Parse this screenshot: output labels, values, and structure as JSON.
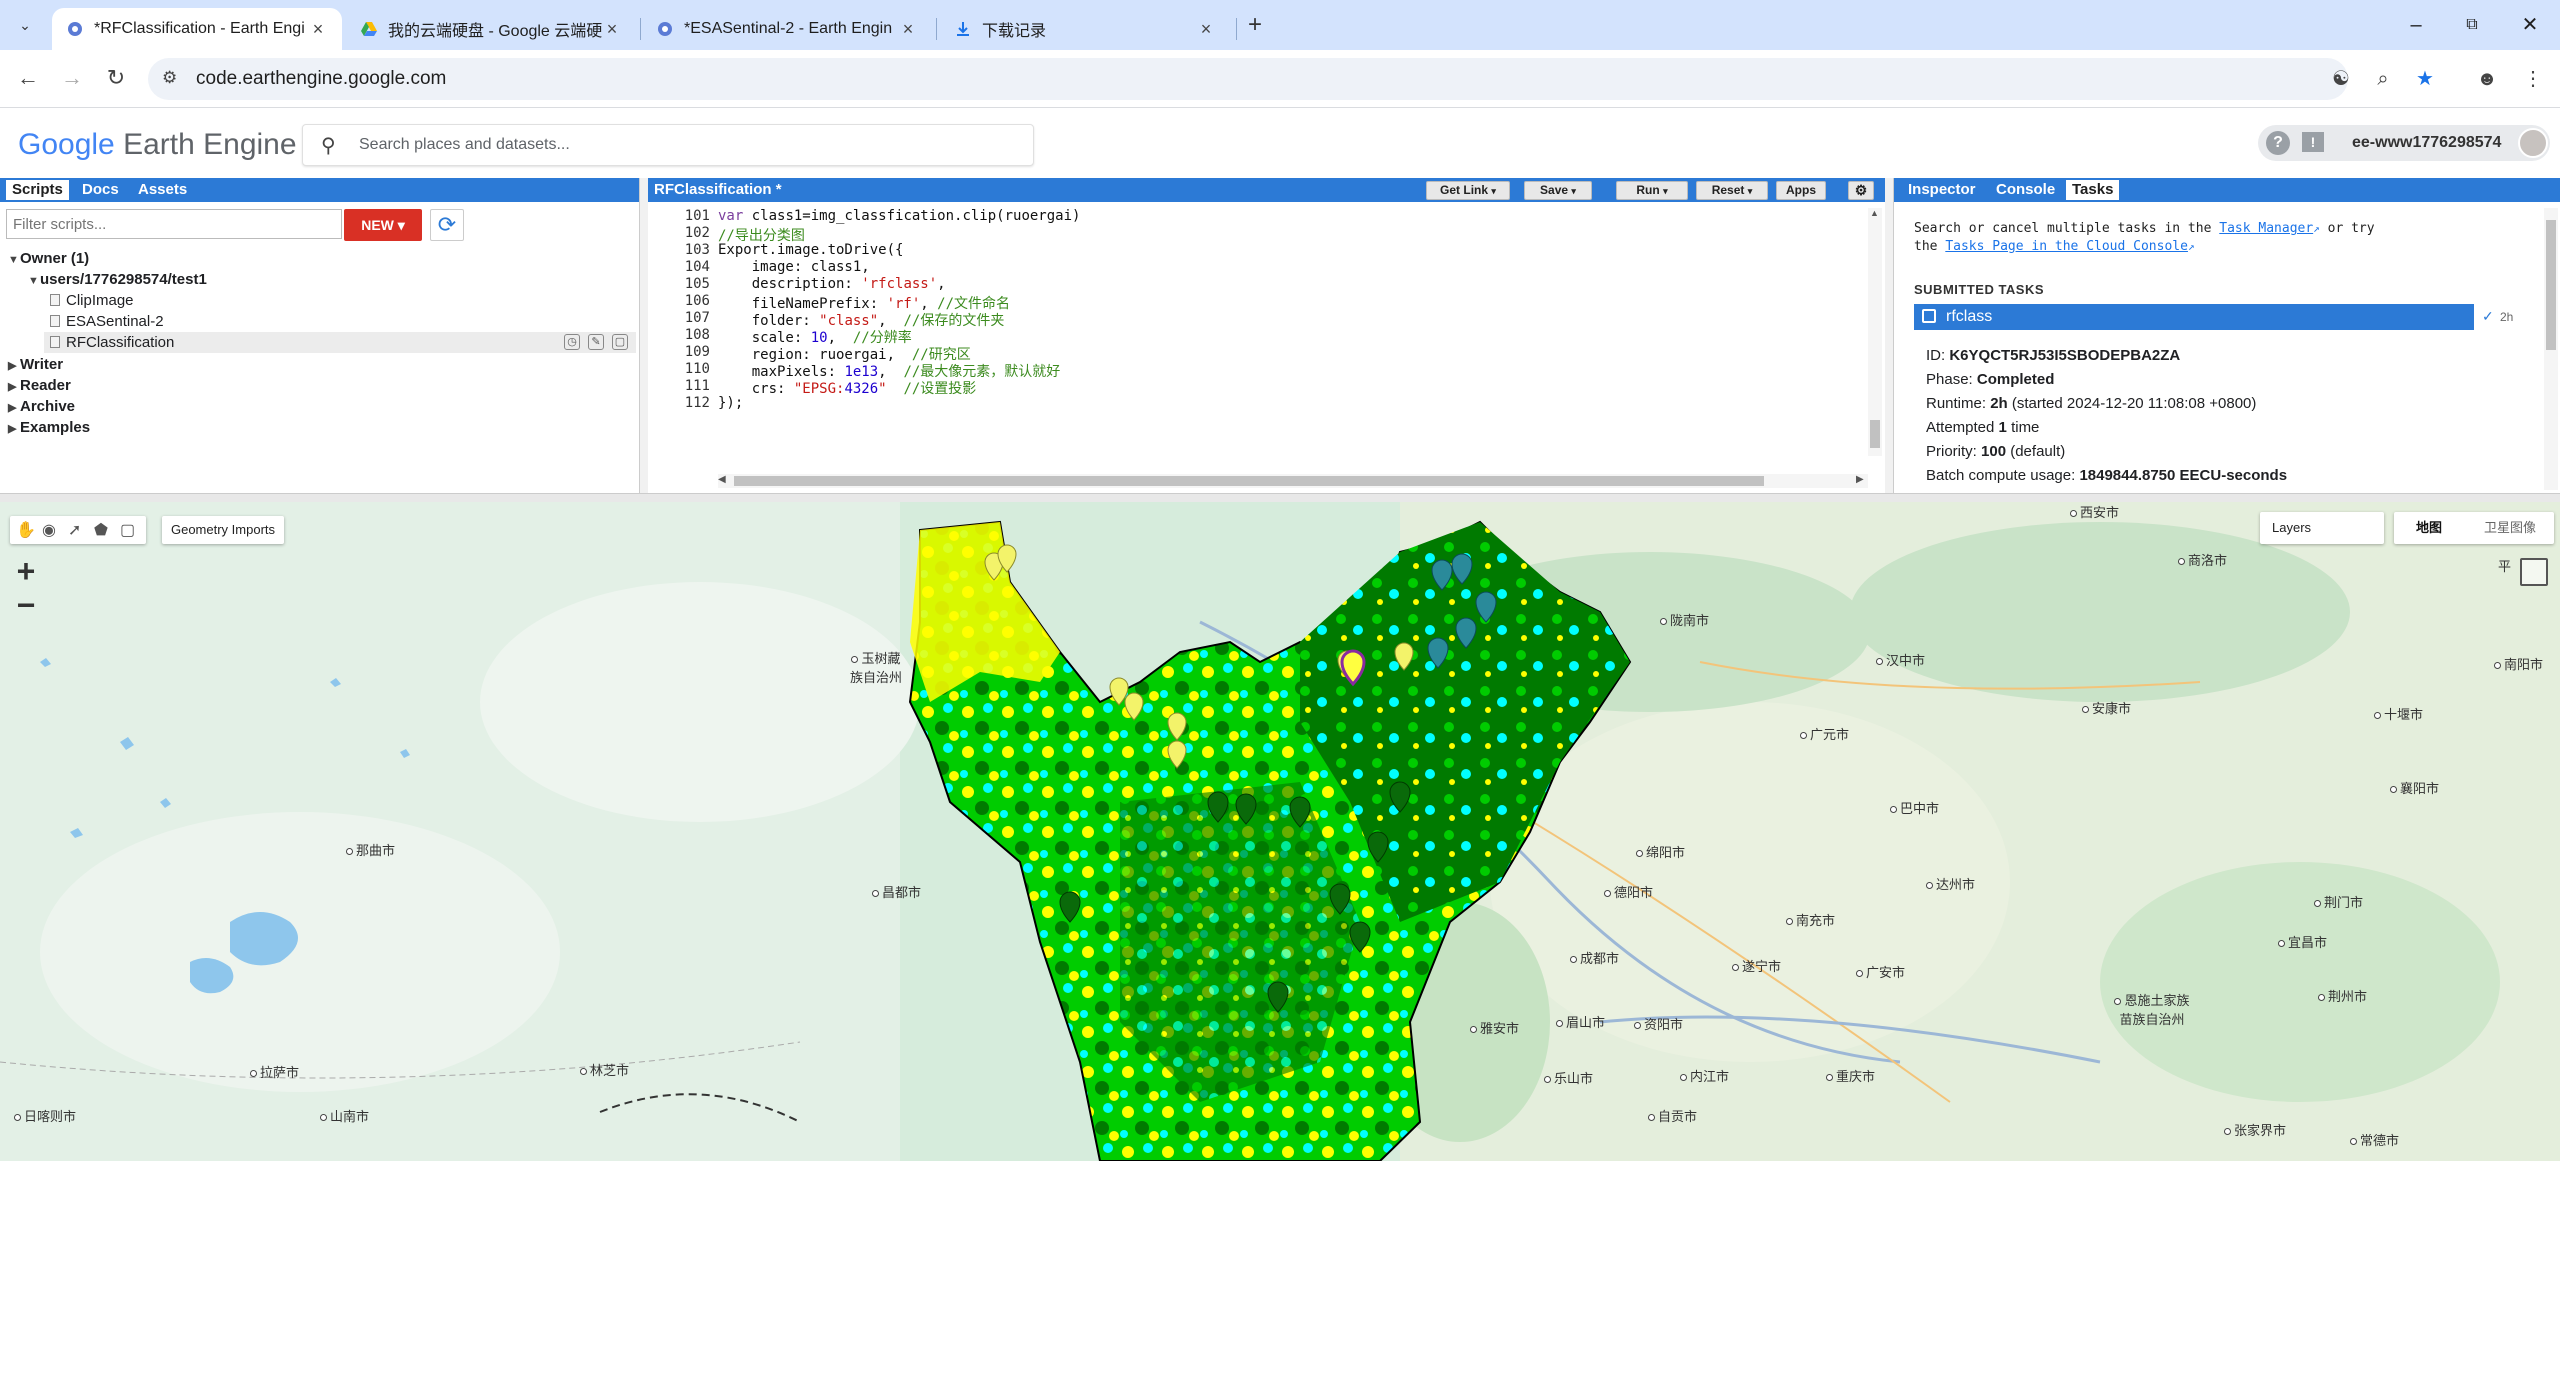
{
  "browser": {
    "tabs": [
      {
        "title": "*RFClassification - Earth Engi",
        "active": true
      },
      {
        "title": "我的云端硬盘 - Google 云端硬",
        "active": false
      },
      {
        "title": "*ESASentinal-2 - Earth Engin",
        "active": false
      },
      {
        "title": "下载记录",
        "active": false
      }
    ],
    "new_tab": "+",
    "url": "code.earthengine.google.com"
  },
  "gee": {
    "logo_google": "Google",
    "logo_product": "Earth Engine",
    "search_placeholder": "Search places and datasets...",
    "username": "ee-www1776298574"
  },
  "left_panel": {
    "tabs": [
      "Scripts",
      "Docs",
      "Assets"
    ],
    "filter_placeholder": "Filter scripts...",
    "new_button": "NEW",
    "tree": {
      "owner": "Owner (1)",
      "repo": "users/1776298574/test1",
      "files": [
        "ClipImage",
        "ESASentinal-2",
        "RFClassification"
      ],
      "groups": [
        "Writer",
        "Reader",
        "Archive",
        "Examples"
      ]
    }
  },
  "code_panel": {
    "title": "RFClassification *",
    "buttons": {
      "get_link": "Get Link",
      "save": "Save",
      "run": "Run",
      "reset": "Reset",
      "apps": "Apps"
    },
    "lines": [
      {
        "n": "101",
        "text": "var class1=img_classfication.clip(ruoergai)"
      },
      {
        "n": "102",
        "text": "//导出分类图"
      },
      {
        "n": "103",
        "text": "Export.image.toDrive({"
      },
      {
        "n": "104",
        "text": "    image: class1,"
      },
      {
        "n": "105",
        "text": "    description: 'rfclass',"
      },
      {
        "n": "106",
        "text": "    fileNamePrefix: 'rf', //文件命名"
      },
      {
        "n": "107",
        "text": "    folder: \"class\",  //保存的文件夹"
      },
      {
        "n": "108",
        "text": "    scale: 10,  //分辨率"
      },
      {
        "n": "109",
        "text": "    region: ruoergai,  //研究区"
      },
      {
        "n": "110",
        "text": "    maxPixels: 1e13,  //最大像元素，默认就好"
      },
      {
        "n": "111",
        "text": "    crs: \"EPSG:4326\"  //设置投影"
      },
      {
        "n": "112",
        "text": "});"
      }
    ]
  },
  "right_panel": {
    "tabs": [
      "Inspector",
      "Console",
      "Tasks"
    ],
    "intro_1": "Search or cancel multiple tasks in the",
    "task_manager_link": "Task Manager",
    "intro_2": "or try",
    "intro_3": "the",
    "cloud_console_link": "Tasks Page in the Cloud Console",
    "submitted_header": "SUBMITTED TASKS",
    "task": {
      "name": "rfclass",
      "duration": "2h",
      "id_label": "ID:",
      "id": "K6YQCT5RJ53I5SBODEPBA2ZA",
      "phase_label": "Phase:",
      "phase": "Completed",
      "runtime_label": "Runtime:",
      "runtime_value": "2h",
      "runtime_note": "(started 2024-12-20 11:08:08 +0800)",
      "attempted_label": "Attempted",
      "attempted_value": "1",
      "attempted_unit": "time",
      "priority_label": "Priority:",
      "priority_value": "100",
      "priority_note": "(default)",
      "batch_label": "Batch compute usage:",
      "batch_value": "1849844.8750 EECU-seconds"
    }
  },
  "map": {
    "geometry_imports": "Geometry Imports",
    "layers": "Layers",
    "map_type": "地图",
    "satellite": "卫星图像",
    "zoom_in": "+",
    "zoom_out": "−",
    "cities": [
      "玉树藏族自治州",
      "那曲市",
      "昌都市",
      "林芝市",
      "拉萨市",
      "日喀则市",
      "山南市",
      "西安市",
      "商洛市",
      "陇南市",
      "汉中市",
      "安康市",
      "十堰市",
      "南阳市",
      "襄阳市",
      "广元市",
      "巴中市",
      "达州市",
      "绵阳市",
      "德阳市",
      "成都市",
      "南充市",
      "遂宁市",
      "广安市",
      "雅安市",
      "眉山市",
      "资阳市",
      "乐山市",
      "内江市",
      "自贡市",
      "重庆市",
      "恩施土家族苗族自治州",
      "宜昌市",
      "荆门市",
      "荆州市",
      "张家界市",
      "常德市",
      "平"
    ]
  },
  "colors": {
    "tab_strip": "#d3e3fd",
    "panel_blue": "#2c7ad6",
    "new_button": "#d93025",
    "class_yellow": "#ffff00",
    "class_cyan": "#00ffff",
    "class_green": "#00cc00",
    "class_dark_green": "#007a00"
  }
}
